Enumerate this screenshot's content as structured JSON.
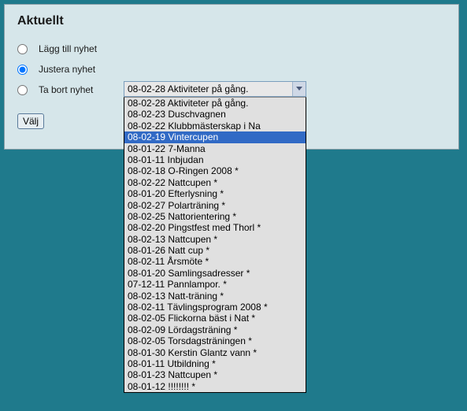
{
  "panel": {
    "heading": "Aktuellt",
    "options": {
      "add": "Lägg till nyhet",
      "edit": "Justera nyhet",
      "delete": "Ta bort nyhet"
    },
    "button": "Välj"
  },
  "selected_option": "edit",
  "dropdown": {
    "current": "08-02-28 Aktiviteter på gång.",
    "highlighted_index": 3,
    "items": [
      "08-02-28 Aktiviteter på gång.",
      "08-02-23 Duschvagnen",
      "08-02-22 Klubbmästerskap i Na",
      "08-02-19 Vintercupen",
      "08-01-22 7-Manna",
      "08-01-11 Inbjudan",
      "08-02-18 O-Ringen 2008 *",
      "08-02-22 Nattcupen *",
      "08-01-20 Efterlysning *",
      "08-02-27 Polarträning *",
      "08-02-25 Nattorientering *",
      "08-02-20 Pingstfest med Thorl *",
      "08-02-13 Nattcupen *",
      "08-01-26 Natt cup *",
      "08-02-11 Årsmöte *",
      "08-01-20 Samlingsadresser *",
      "07-12-11 Pannlampor. *",
      "08-02-13 Natt-träning *",
      "08-02-11 Tävlingsprogram 2008 *",
      "08-02-05 Flickorna bäst i Nat *",
      "08-02-09 Lördagsträning *",
      "08-02-05 Torsdagsträningen *",
      "08-01-30 Kerstin Glantz vann *",
      "08-01-11 Utbildning *",
      "08-01-23 Nattcupen *",
      "08-01-12 !!!!!!!! *"
    ]
  }
}
